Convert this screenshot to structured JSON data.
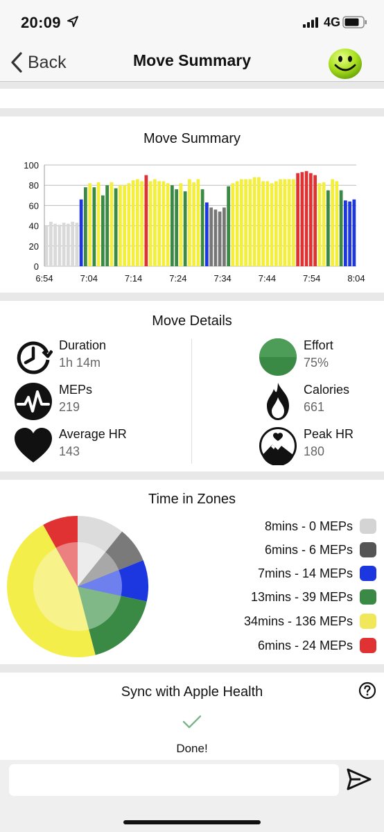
{
  "status": {
    "time": "20:09",
    "network": "4G",
    "icons": [
      "location-arrow-icon",
      "signal-bars-icon",
      "battery-icon"
    ]
  },
  "nav": {
    "back_label": "Back",
    "title": "Move Summary",
    "avatar_icon": "smiley-face-icon"
  },
  "summary_card": {
    "title": "Move Summary"
  },
  "chart_data": {
    "type": "bar",
    "title": "Move Summary",
    "xlabel": "",
    "ylabel": "",
    "ylim": [
      0,
      100
    ],
    "yticks": [
      0,
      20,
      40,
      60,
      80,
      100
    ],
    "xticks": [
      "6:54",
      "7:04",
      "7:14",
      "7:24",
      "7:34",
      "7:44",
      "7:54",
      "8:04"
    ],
    "grid": true,
    "zone_colors": {
      "grey": "#d9d9d9",
      "darkgrey": "#777777",
      "blue": "#1c36e0",
      "green": "#3a8a45",
      "yellow": "#f4ee3c",
      "red": "#e03232"
    },
    "bars": [
      {
        "v": 40,
        "z": "grey"
      },
      {
        "v": 44,
        "z": "grey"
      },
      {
        "v": 42,
        "z": "grey"
      },
      {
        "v": 41,
        "z": "grey"
      },
      {
        "v": 43,
        "z": "grey"
      },
      {
        "v": 42,
        "z": "grey"
      },
      {
        "v": 44,
        "z": "grey"
      },
      {
        "v": 43,
        "z": "grey"
      },
      {
        "v": 66,
        "z": "blue"
      },
      {
        "v": 78,
        "z": "green"
      },
      {
        "v": 82,
        "z": "yellow"
      },
      {
        "v": 78,
        "z": "green"
      },
      {
        "v": 83,
        "z": "yellow"
      },
      {
        "v": 70,
        "z": "green"
      },
      {
        "v": 80,
        "z": "green"
      },
      {
        "v": 83,
        "z": "yellow"
      },
      {
        "v": 77,
        "z": "green"
      },
      {
        "v": 80,
        "z": "yellow"
      },
      {
        "v": 80,
        "z": "yellow"
      },
      {
        "v": 82,
        "z": "yellow"
      },
      {
        "v": 85,
        "z": "yellow"
      },
      {
        "v": 86,
        "z": "yellow"
      },
      {
        "v": 84,
        "z": "yellow"
      },
      {
        "v": 90,
        "z": "red"
      },
      {
        "v": 84,
        "z": "yellow"
      },
      {
        "v": 86,
        "z": "yellow"
      },
      {
        "v": 84,
        "z": "yellow"
      },
      {
        "v": 84,
        "z": "yellow"
      },
      {
        "v": 82,
        "z": "yellow"
      },
      {
        "v": 80,
        "z": "green"
      },
      {
        "v": 76,
        "z": "green"
      },
      {
        "v": 82,
        "z": "yellow"
      },
      {
        "v": 74,
        "z": "green"
      },
      {
        "v": 86,
        "z": "yellow"
      },
      {
        "v": 83,
        "z": "yellow"
      },
      {
        "v": 86,
        "z": "yellow"
      },
      {
        "v": 76,
        "z": "green"
      },
      {
        "v": 63,
        "z": "blue"
      },
      {
        "v": 58,
        "z": "darkgrey"
      },
      {
        "v": 56,
        "z": "darkgrey"
      },
      {
        "v": 54,
        "z": "darkgrey"
      },
      {
        "v": 58,
        "z": "darkgrey"
      },
      {
        "v": 79,
        "z": "green"
      },
      {
        "v": 82,
        "z": "yellow"
      },
      {
        "v": 84,
        "z": "yellow"
      },
      {
        "v": 86,
        "z": "yellow"
      },
      {
        "v": 86,
        "z": "yellow"
      },
      {
        "v": 86,
        "z": "yellow"
      },
      {
        "v": 88,
        "z": "yellow"
      },
      {
        "v": 88,
        "z": "yellow"
      },
      {
        "v": 84,
        "z": "yellow"
      },
      {
        "v": 84,
        "z": "yellow"
      },
      {
        "v": 82,
        "z": "yellow"
      },
      {
        "v": 84,
        "z": "yellow"
      },
      {
        "v": 86,
        "z": "yellow"
      },
      {
        "v": 86,
        "z": "yellow"
      },
      {
        "v": 86,
        "z": "yellow"
      },
      {
        "v": 86,
        "z": "yellow"
      },
      {
        "v": 92,
        "z": "red"
      },
      {
        "v": 93,
        "z": "red"
      },
      {
        "v": 94,
        "z": "red"
      },
      {
        "v": 92,
        "z": "red"
      },
      {
        "v": 90,
        "z": "red"
      },
      {
        "v": 82,
        "z": "yellow"
      },
      {
        "v": 83,
        "z": "yellow"
      },
      {
        "v": 75,
        "z": "green"
      },
      {
        "v": 86,
        "z": "yellow"
      },
      {
        "v": 84,
        "z": "yellow"
      },
      {
        "v": 75,
        "z": "green"
      },
      {
        "v": 65,
        "z": "blue"
      },
      {
        "v": 64,
        "z": "blue"
      },
      {
        "v": 66,
        "z": "blue"
      }
    ]
  },
  "details_card": {
    "title": "Move Details",
    "items": [
      {
        "label": "Duration",
        "value": "1h 14m",
        "icon": "clock-icon"
      },
      {
        "label": "MEPs",
        "value": "219",
        "icon": "heartbeat-pulse-icon"
      },
      {
        "label": "Average HR",
        "value": "143",
        "icon": "heart-icon"
      },
      {
        "label": "Effort",
        "value": "75%",
        "icon": "effort-circle-icon"
      },
      {
        "label": "Calories",
        "value": "661",
        "icon": "flame-icon"
      },
      {
        "label": "Peak HR",
        "value": "180",
        "icon": "mountain-heart-icon"
      }
    ]
  },
  "zones_card": {
    "title": "Time in Zones",
    "zones": [
      {
        "label": "8mins - 0 MEPs",
        "minutes": 8,
        "color": "#dcdcdc",
        "inner": "#ececec"
      },
      {
        "label": "6mins - 6 MEPs",
        "minutes": 6,
        "color": "#7a7a7a",
        "inner": "#a8a8a8"
      },
      {
        "label": "7mins - 14 MEPs",
        "minutes": 7,
        "color": "#1c36e0",
        "inner": "#6e80ee"
      },
      {
        "label": "13mins - 39 MEPs",
        "minutes": 13,
        "color": "#3a8a45",
        "inner": "#80b888"
      },
      {
        "label": "34mins - 136 MEPs",
        "minutes": 34,
        "color": "#f4ee4a",
        "inner": "#f7f28a"
      },
      {
        "label": "6mins - 24 MEPs",
        "minutes": 6,
        "color": "#e03232",
        "inner": "#ec8080"
      }
    ]
  },
  "sync_card": {
    "title": "Sync with Apple Health",
    "status": "Done!",
    "help_icon": "question-circle-icon",
    "check_icon": "checkmark-icon"
  },
  "footer": {
    "input_placeholder": "",
    "send_icon": "send-arrow-icon"
  }
}
